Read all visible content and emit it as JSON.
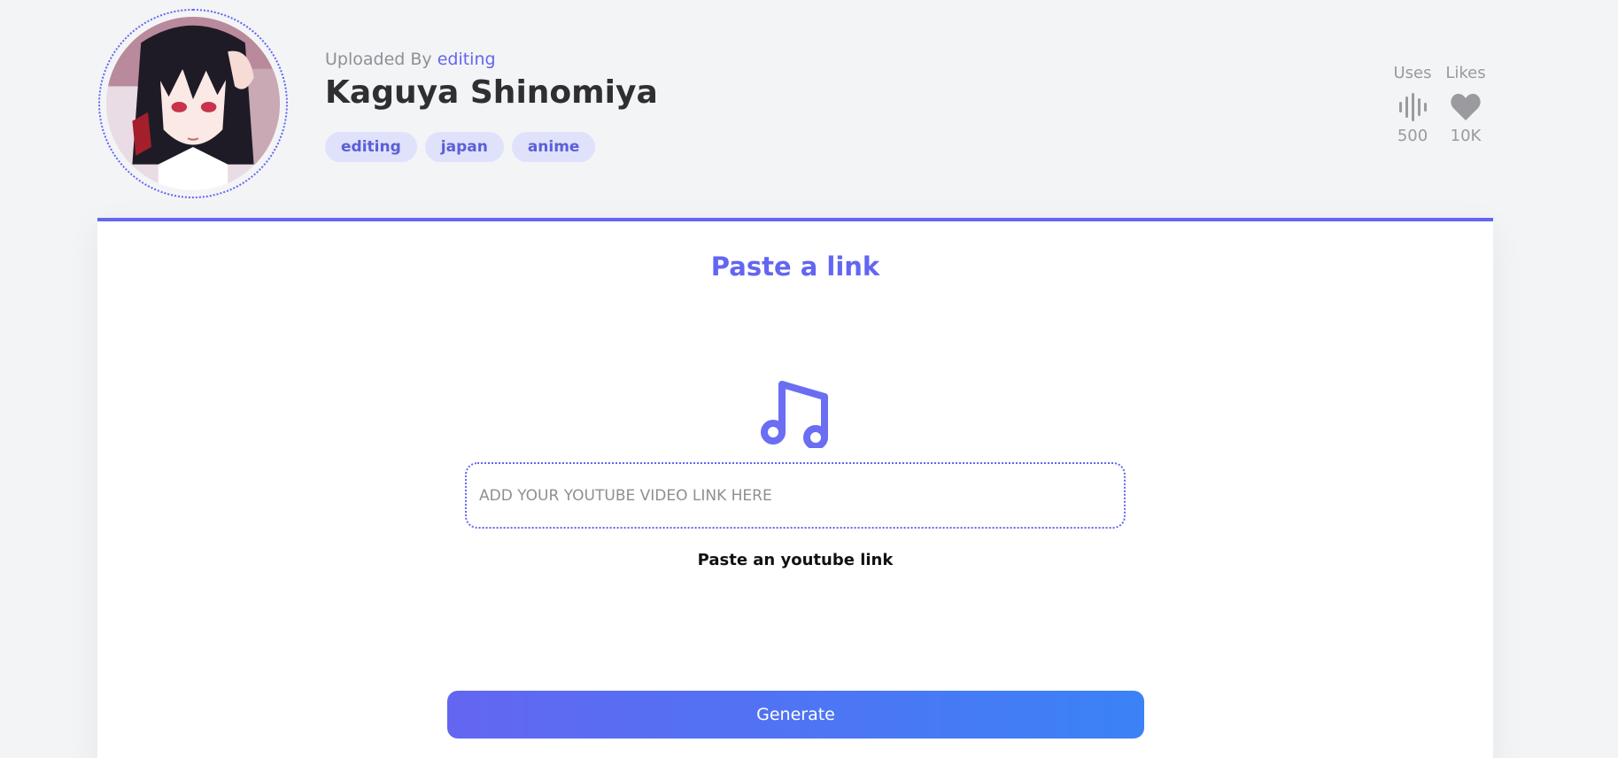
{
  "header": {
    "uploaded_by_prefix": "Uploaded By",
    "uploaded_by_user": "editing",
    "title": "Kaguya Shinomiya",
    "tags": [
      "editing",
      "japan",
      "anime"
    ],
    "stats": {
      "uses": {
        "label": "Uses",
        "value": "500",
        "icon": "sound-wave-icon"
      },
      "likes": {
        "label": "Likes",
        "value": "10K",
        "icon": "heart-icon"
      }
    },
    "avatar_icon": "character-avatar"
  },
  "main": {
    "title": "Paste a link",
    "icon": "music-note-icon",
    "input": {
      "placeholder": "ADD YOUR YOUTUBE VIDEO LINK HERE",
      "value": ""
    },
    "helper_text": "Paste an youtube link",
    "generate_label": "Generate"
  },
  "colors": {
    "accent": "#6366f1",
    "gradient_end": "#3b82f6",
    "background": "#f3f4f6",
    "tag_bg": "#e0e1fb"
  }
}
